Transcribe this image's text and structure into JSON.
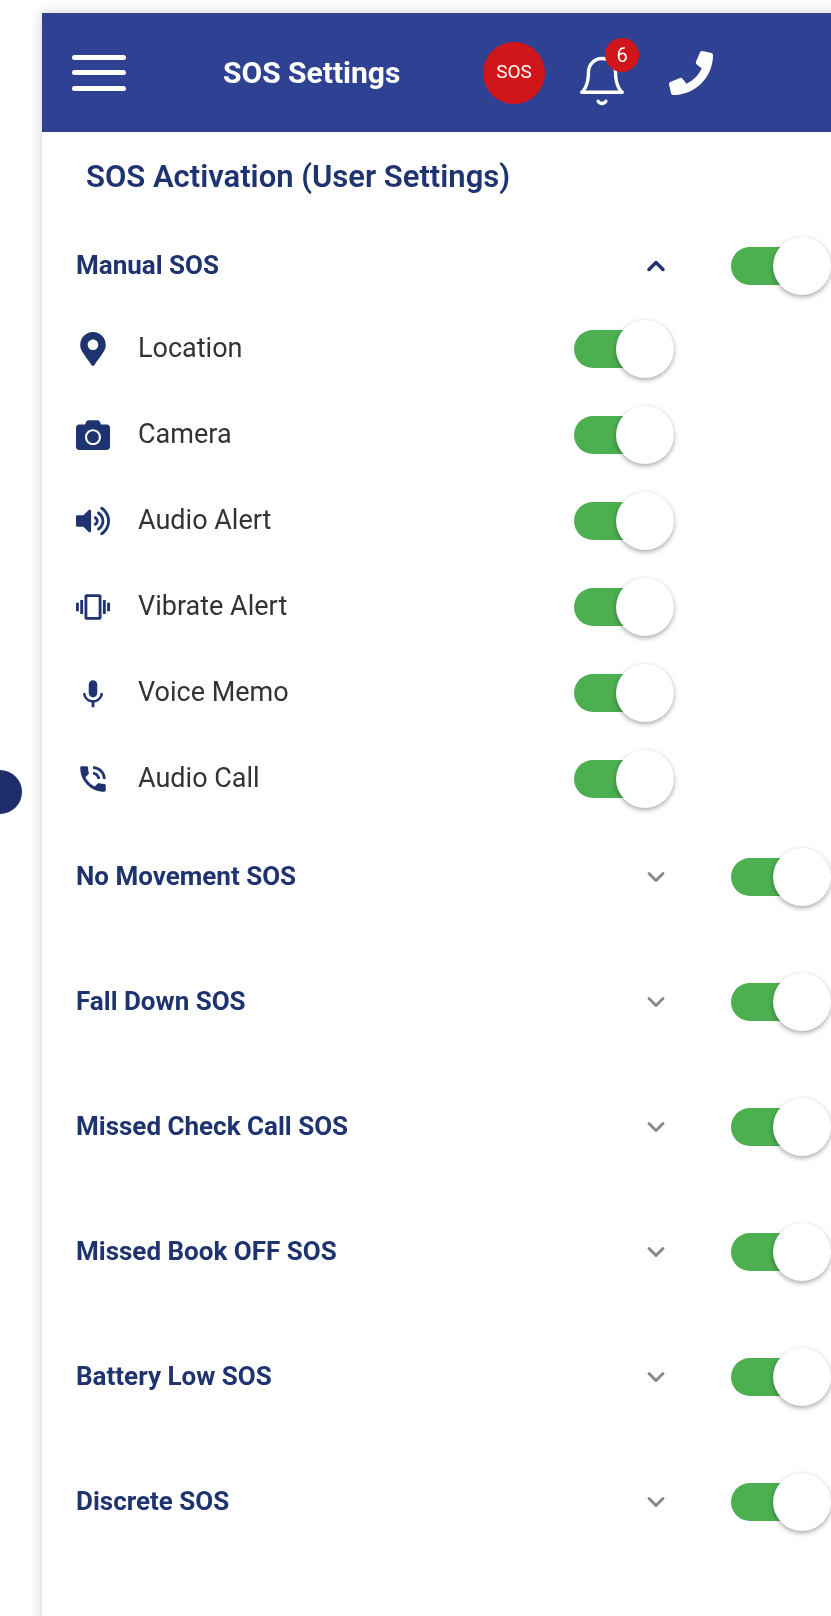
{
  "header": {
    "title": "SOS Settings",
    "sos_badge": "SOS",
    "notification_count": "6"
  },
  "page_title": "SOS Activation (User Settings)",
  "sections": [
    {
      "label": "Manual SOS",
      "expanded": true,
      "on": true,
      "items": [
        {
          "label": "Location",
          "on": true
        },
        {
          "label": "Camera",
          "on": true
        },
        {
          "label": "Audio Alert",
          "on": true
        },
        {
          "label": "Vibrate Alert",
          "on": true
        },
        {
          "label": "Voice Memo",
          "on": true
        },
        {
          "label": "Audio Call",
          "on": true
        }
      ]
    },
    {
      "label": "No Movement SOS",
      "expanded": false,
      "on": true
    },
    {
      "label": "Fall Down SOS",
      "expanded": false,
      "on": true
    },
    {
      "label": "Missed Check Call SOS",
      "expanded": false,
      "on": true
    },
    {
      "label": "Missed Book OFF SOS",
      "expanded": false,
      "on": true
    },
    {
      "label": "Battery Low SOS",
      "expanded": false,
      "on": true
    },
    {
      "label": "Discrete SOS",
      "expanded": false,
      "on": true
    }
  ]
}
